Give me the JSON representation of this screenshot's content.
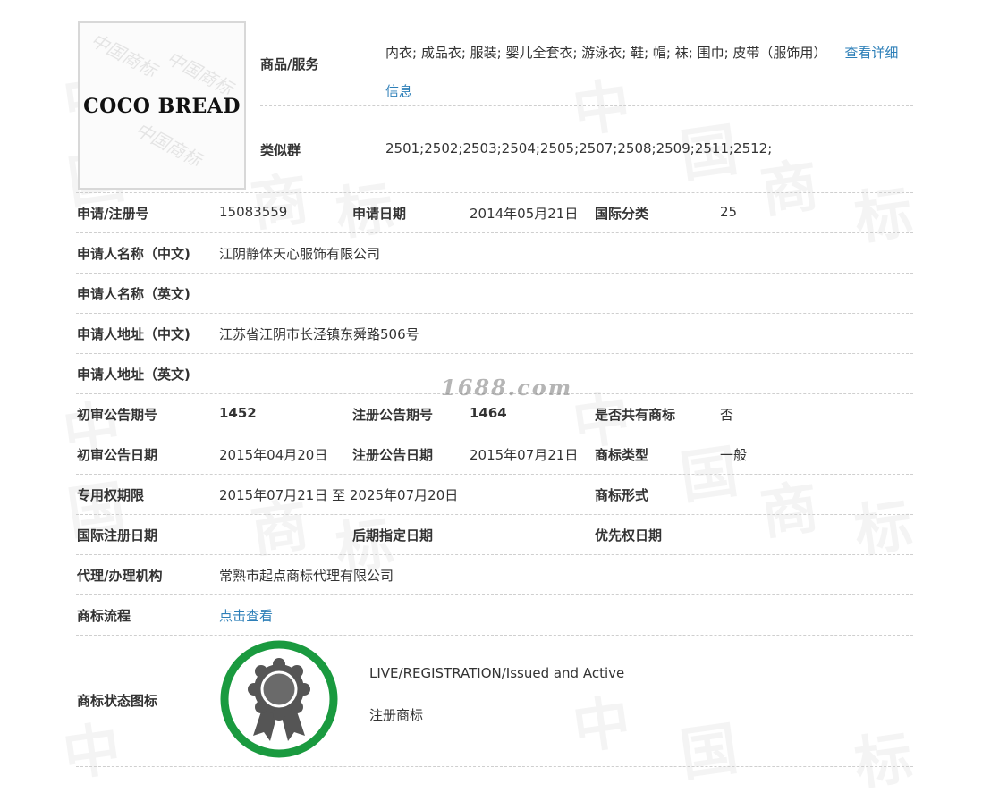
{
  "logo": {
    "text": "COCO BREAD"
  },
  "header": {
    "goods_label": "商品/服务",
    "goods_value": "内衣; 成品衣; 服装; 婴儿全套衣; 游泳衣; 鞋; 帽; 袜; 围巾; 皮带（服饰用）",
    "detail_link_part1": "查看详细",
    "detail_link_part2": "信息",
    "similar_label": "类似群",
    "similar_value": "2501;2502;2503;2504;2505;2507;2508;2509;2511;2512;"
  },
  "rows": {
    "reg_no_label": "申请/注册号",
    "reg_no": "15083559",
    "apply_date_label": "申请日期",
    "apply_date": "2014年05月21日",
    "intl_class_label": "国际分类",
    "intl_class": "25",
    "applicant_cn_label": "申请人名称（中文)",
    "applicant_cn": "江阴静体天心服饰有限公司",
    "applicant_en_label": "申请人名称（英文)",
    "applicant_en": "",
    "address_cn_label": "申请人地址（中文)",
    "address_cn": "江苏省江阴市长泾镇东舜路506号",
    "address_en_label": "申请人地址（英文)",
    "address_en": "",
    "prelim_issue_label": "初审公告期号",
    "prelim_issue": "1452",
    "reg_issue_label": "注册公告期号",
    "reg_issue": "1464",
    "shared_label": "是否共有商标",
    "shared": "否",
    "prelim_date_label": "初审公告日期",
    "prelim_date": "2015年04月20日",
    "reg_date_label": "注册公告日期",
    "reg_date": "2015年07月21日",
    "tm_type_label": "商标类型",
    "tm_type": "一般",
    "exclusive_label": "专用权期限",
    "exclusive": "2015年07月21日 至 2025年07月20日",
    "tm_form_label": "商标形式",
    "tm_form": "",
    "intl_reg_date_label": "国际注册日期",
    "later_designation_label": "后期指定日期",
    "priority_date_label": "优先权日期",
    "agent_label": "代理/办理机构",
    "agent": "常熟市起点商标代理有限公司",
    "process_label": "商标流程",
    "process_link": "点击查看"
  },
  "status": {
    "label": "商标状态图标",
    "en": "LIVE/REGISTRATION/Issued and Active",
    "cn": "注册商标"
  },
  "watermark": {
    "site": "1688.com",
    "glyph_a": "中",
    "glyph_b": "国",
    "glyph_c": "商",
    "glyph_d": "标",
    "logo_bg": "中国商标"
  },
  "colors": {
    "link": "#2d7fb8",
    "status_ring": "#1a9a3f",
    "medal": "#555555"
  }
}
